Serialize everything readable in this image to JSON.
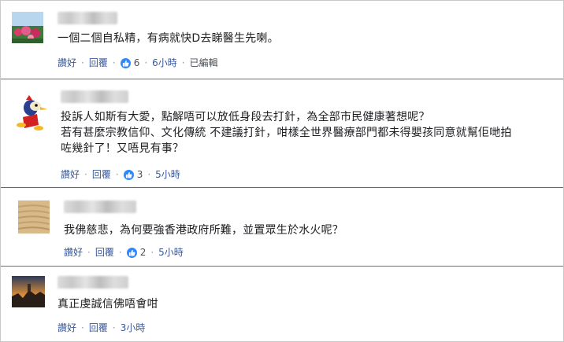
{
  "comments": [
    {
      "text_lines": [
        "一個二個自私精，有病就快D去睇醫生先喇。"
      ],
      "actions": {
        "like": "讚好",
        "reply": "回覆",
        "like_count": "6",
        "time": "6小時",
        "edited": "已編輯"
      }
    },
    {
      "text_lines": [
        "投訴人如斯有大愛，點解唔可以放低身段去打針，為全部市民健康著想呢？",
        "若有甚麼宗教信仰、文化傳統 不建議打針，咁樣全世界醫療部門都未得嬰孩同意就幫佢哋拍",
        "咗幾針了！又唔見有事？"
      ],
      "actions": {
        "like": "讚好",
        "reply": "回覆",
        "like_count": "3",
        "time": "5小時"
      }
    },
    {
      "text_lines": [
        "我佛慈悲，為何要強香港政府所難，並置眾生於水火呢？"
      ],
      "actions": {
        "like": "讚好",
        "reply": "回覆",
        "like_count": "2",
        "time": "5小時"
      }
    },
    {
      "text_lines": [
        "真正虔誠信佛唔會咁"
      ],
      "actions": {
        "like": "讚好",
        "reply": "回覆",
        "time": "3小時"
      }
    }
  ],
  "icons": {
    "like": "thumbs-up-icon"
  },
  "colors": {
    "link": "#385898",
    "like_badge": "#2d88ff"
  }
}
